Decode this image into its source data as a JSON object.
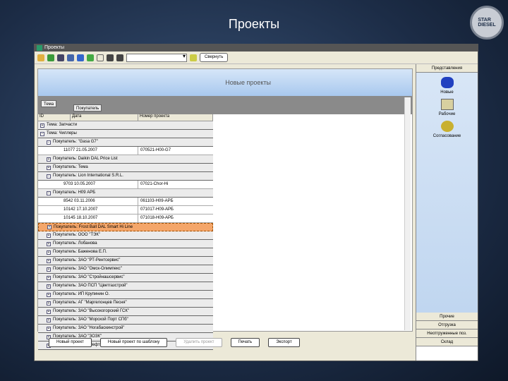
{
  "slide_title": "Проекты",
  "logo_text": "STARDIESEL",
  "window": {
    "title": "Проекты"
  },
  "toolbar": {
    "combo_value": "",
    "button_label": "Свернуть"
  },
  "banner": "Новые проекты",
  "group_chips": [
    "Тема",
    "Покупатель"
  ],
  "columns": [
    "ID",
    "Дата",
    "Номер проекта"
  ],
  "rows": [
    {
      "t": "g",
      "lvl": 0,
      "sign": "+",
      "text": "Тема: Запчасти"
    },
    {
      "t": "g",
      "lvl": 0,
      "sign": "−",
      "text": "Тема: Чиллеры"
    },
    {
      "t": "g",
      "lvl": 1,
      "sign": "−",
      "text": "Покупатель: \"Gasa G7\""
    },
    {
      "t": "d",
      "c1": "11077 21.05.2007",
      "c2": "070521-H00-G7"
    },
    {
      "t": "g",
      "lvl": 1,
      "sign": "+",
      "text": "Покупатель: Daikin DAL Price List"
    },
    {
      "t": "g",
      "lvl": 1,
      "sign": "+",
      "text": "Покупатель: Тема"
    },
    {
      "t": "g",
      "lvl": 1,
      "sign": "−",
      "text": "Покупатель: Lion International S.R.L."
    },
    {
      "t": "d",
      "c1": "9703 10.05.2007",
      "c2": "07021-Chor-Hi"
    },
    {
      "t": "g",
      "lvl": 1,
      "sign": "−",
      "text": "Покупатель: H09 АРБ"
    },
    {
      "t": "d",
      "c1": "8542 03.11.2006",
      "c2": "061103-H09-АРБ"
    },
    {
      "t": "d",
      "c1": "10142 17.10.2007",
      "c2": "071017-H09-АРБ"
    },
    {
      "t": "d",
      "c1": "10145 18.10.2007",
      "c2": "071018-H09-АРБ"
    },
    {
      "t": "g",
      "lvl": 1,
      "sign": "+",
      "text": "Покупатель: Frost Ball DAL Smart Hi Line",
      "sel": true
    },
    {
      "t": "g",
      "lvl": 1,
      "sign": "+",
      "text": "Покупатель: ООО \"ТЭК\""
    },
    {
      "t": "g",
      "lvl": 1,
      "sign": "+",
      "text": "Покупатель: Лобанова"
    },
    {
      "t": "g",
      "lvl": 1,
      "sign": "+",
      "text": "Покупатель: Баженова Е.П."
    },
    {
      "t": "g",
      "lvl": 1,
      "sign": "+",
      "text": "Покупатель: ЗАО \"РТ-Рентсервис\""
    },
    {
      "t": "g",
      "lvl": 1,
      "sign": "+",
      "text": "Покупатель: ЗАО \"Омск-Олимпекс\""
    },
    {
      "t": "g",
      "lvl": 1,
      "sign": "+",
      "text": "Покупатель: ЗАО \"Стройнашсервис\""
    },
    {
      "t": "g",
      "lvl": 1,
      "sign": "+",
      "text": "Покупатель: ЗАО ПСП \"Цветгазстрой\""
    },
    {
      "t": "g",
      "lvl": 1,
      "sign": "+",
      "text": "Покупатель: ИП Крупинин О."
    },
    {
      "t": "g",
      "lvl": 1,
      "sign": "+",
      "text": "Покупатель: АГ \"Маргелонцев Песня\""
    },
    {
      "t": "g",
      "lvl": 1,
      "sign": "+",
      "text": "Покупатель: ЗАО \"Высокогорский ГСК\""
    },
    {
      "t": "g",
      "lvl": 1,
      "sign": "+",
      "text": "Покупатель: ЗАО \"Морской Порт СПб\""
    },
    {
      "t": "g",
      "lvl": 1,
      "sign": "+",
      "text": "Покупатель: ЗАО \"Ногабаскинстрой\""
    },
    {
      "t": "g",
      "lvl": 1,
      "sign": "+",
      "text": "Покупатель: ЗАО \"ЗОЗК\""
    },
    {
      "t": "g",
      "lvl": 1,
      "sign": "+",
      "text": "Покупатель: ЗАО \"Нефтегазстройкомплект\""
    }
  ],
  "buttons": [
    "Новый проект",
    "Новый проект по шаблону",
    "Удалить проект",
    "Печать",
    "Экспорт"
  ],
  "side": {
    "header": "Представления",
    "items": [
      "Новые",
      "Рабочие",
      "Согласование"
    ],
    "bottom": [
      "Прочие",
      "Отгрузка",
      "Неотгруженные поз.",
      "Склад"
    ]
  }
}
